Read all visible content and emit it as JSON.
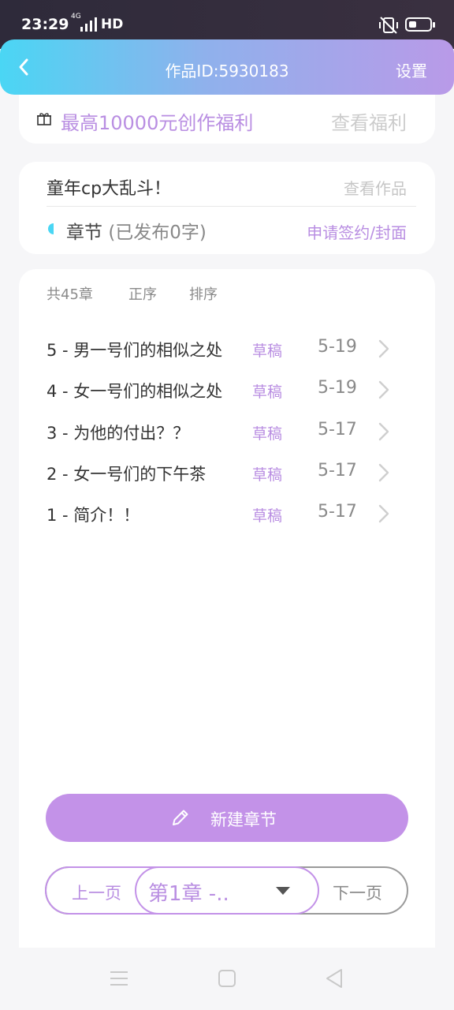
{
  "status_bar": {
    "time": "23:29",
    "network": "4G",
    "hd": "HD"
  },
  "header": {
    "title": "作品ID:5930183",
    "settings_label": "设置"
  },
  "promo": {
    "text": "最高10000元创作福利",
    "link": "查看福利"
  },
  "work": {
    "title": "童年cp大乱斗！",
    "view_link": "查看作品",
    "chapter_label": "章节",
    "published": "(已发布0字)",
    "apply_link": "申请签约/封面"
  },
  "list": {
    "total": "共45章",
    "order": "正序",
    "sort": "排序",
    "chapters": [
      {
        "title": "5 - 男一号们的相似之处",
        "status": "草稿",
        "date": "5-19"
      },
      {
        "title": "4 - 女一号们的相似之处",
        "status": "草稿",
        "date": "5-19"
      },
      {
        "title": "3 - 为他的付出？？",
        "status": "草稿",
        "date": "5-17"
      },
      {
        "title": "2 - 女一号们的下午茶",
        "status": "草稿",
        "date": "5-17"
      },
      {
        "title": "1 - 简介！！",
        "status": "草稿",
        "date": "5-17"
      }
    ]
  },
  "actions": {
    "new_chapter": "新建章节"
  },
  "pager": {
    "prev": "上一页",
    "selected": "第1章 -..",
    "next": "下一页"
  },
  "colors": {
    "accent": "#b98ee2",
    "button": "#c392e8",
    "header_start": "#4ad6f4",
    "header_end": "#b99ae8"
  }
}
